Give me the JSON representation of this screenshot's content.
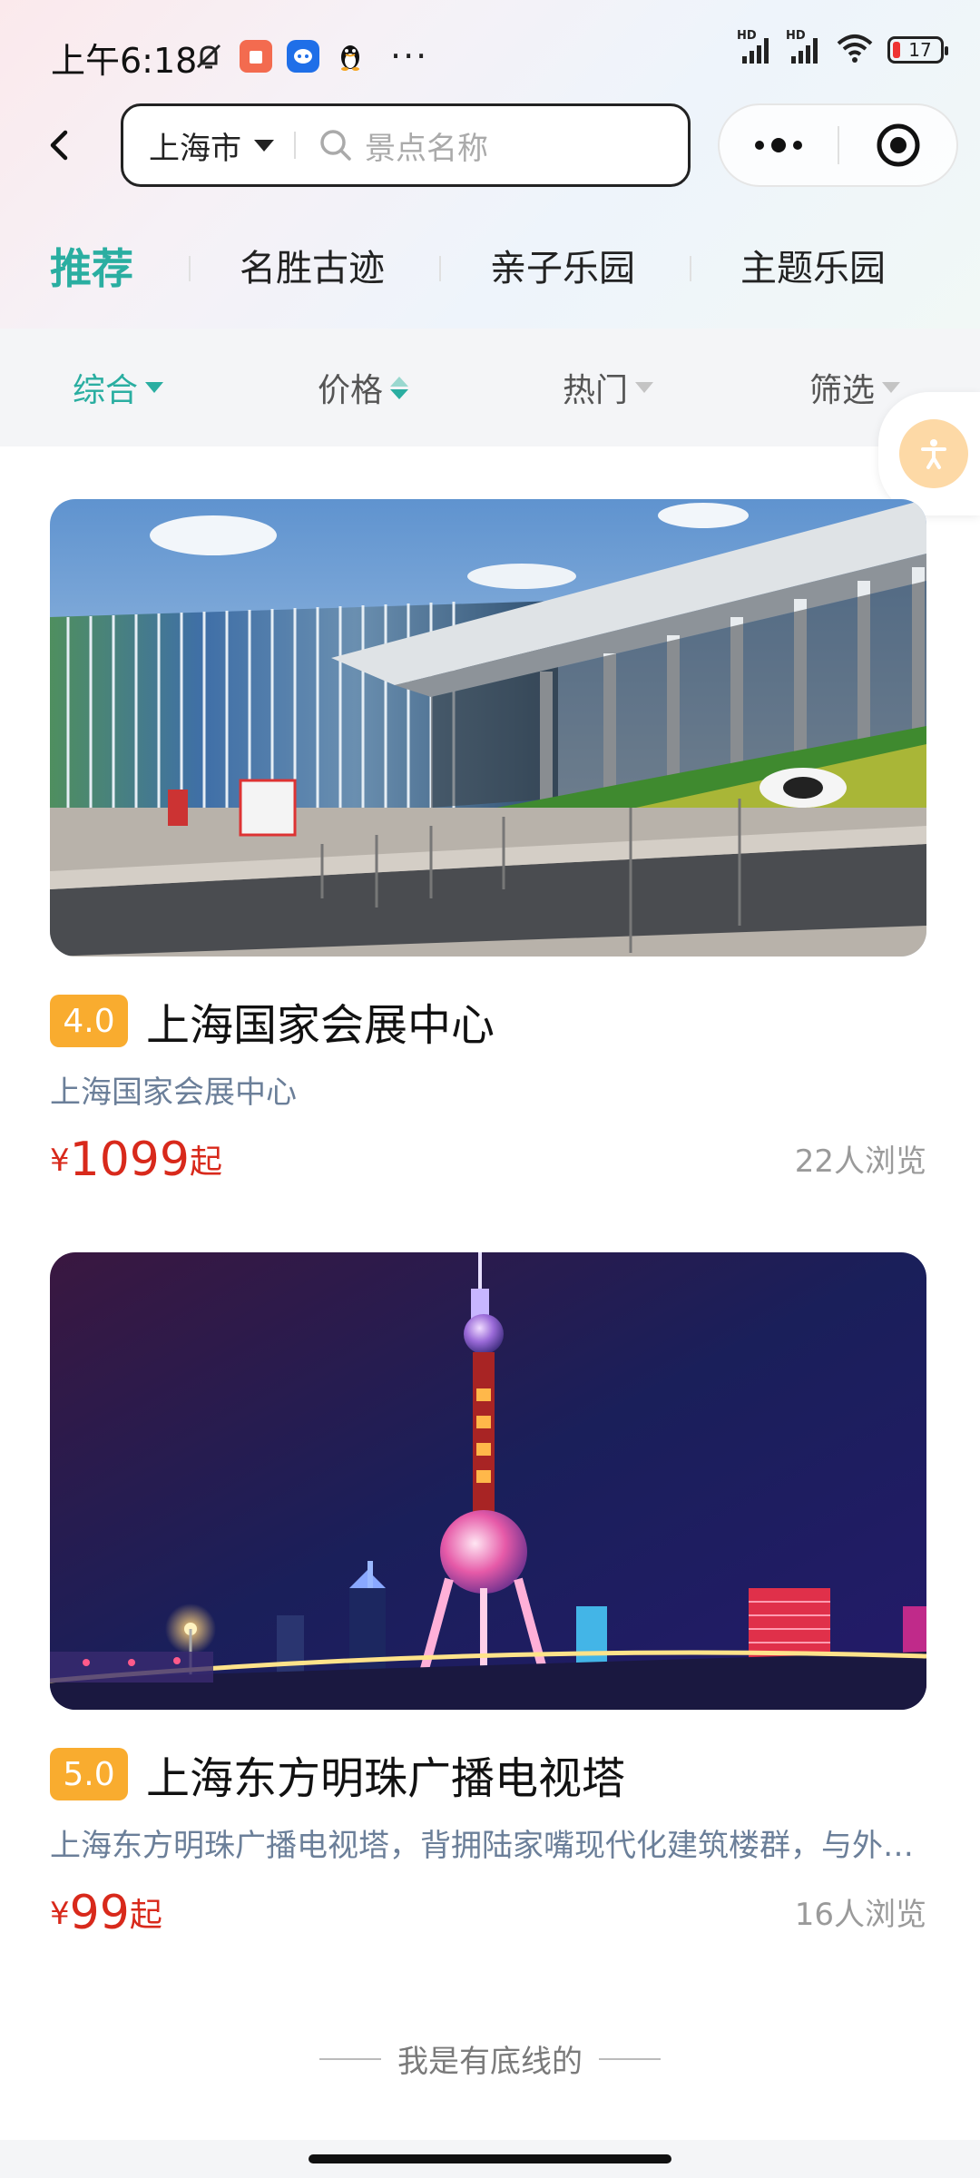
{
  "status_bar": {
    "time": "上午6:18",
    "more": "···",
    "signal_1_label": "HD",
    "signal_2_label": "HD",
    "battery": "17"
  },
  "nav": {
    "city": "上海市",
    "search_placeholder": "景点名称"
  },
  "category_tabs": [
    {
      "label": "推荐",
      "active": true
    },
    {
      "label": "名胜古迹",
      "active": false
    },
    {
      "label": "亲子乐园",
      "active": false
    },
    {
      "label": "主题乐园",
      "active": false
    }
  ],
  "sort_bar": [
    {
      "label": "综合",
      "active": true
    },
    {
      "label": "价格",
      "active": false
    },
    {
      "label": "热门",
      "active": false
    },
    {
      "label": "筛选",
      "active": false
    }
  ],
  "cards": [
    {
      "rating": "4.0",
      "title": "上海国家会展中心",
      "desc": "上海国家会展中心",
      "price_currency": "¥",
      "price_value": "1099",
      "price_suffix": "起",
      "views": "22人浏览"
    },
    {
      "rating": "5.0",
      "title": "上海东方明珠广播电视塔",
      "desc": "上海东方明珠广播电视塔，背拥陆家嘴现代化建筑楼群，与外滩万国建筑博览群隔江相望",
      "price_currency": "¥",
      "price_value": "99",
      "price_suffix": "起",
      "views": "16人浏览"
    }
  ],
  "footer": {
    "note": "我是有底线的"
  },
  "colors": {
    "accent": "#2aaea1",
    "price": "#d8291b",
    "rating_bg": "#f9ac2f"
  }
}
